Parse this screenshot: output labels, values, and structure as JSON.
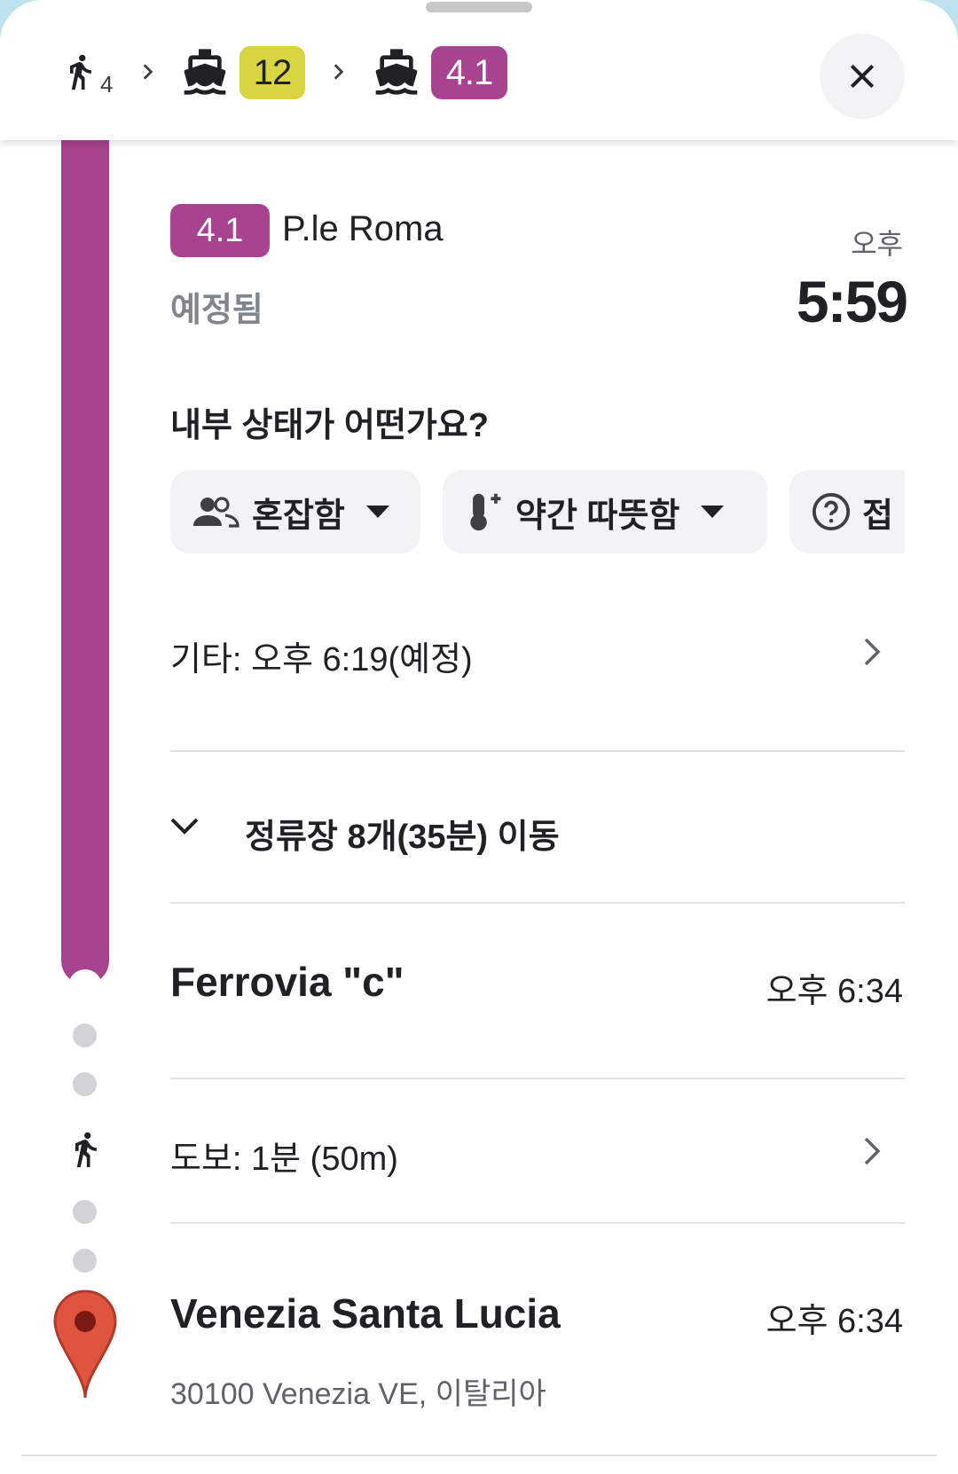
{
  "header": {
    "walk_minutes": "4",
    "legs": [
      {
        "icon": "ferry-icon",
        "line": "12",
        "color": "#d7d540",
        "text_color": "#202124"
      },
      {
        "icon": "ferry-icon",
        "line": "4.1",
        "color": "#a8448f",
        "text_color": "#ffffff"
      }
    ]
  },
  "departure": {
    "line": "4.1",
    "line_color": "#a8448f",
    "stop_name": "P.le Roma",
    "status": "예정됨",
    "time_period": "오후",
    "time": "5:59"
  },
  "crowding": {
    "question": "내부 상태가 어떤가요?",
    "chips": [
      {
        "icon": "people-icon",
        "label": "혼잡함"
      },
      {
        "icon": "thermometer-icon",
        "label": "약간 따뜻함"
      },
      {
        "icon": "help-circle-icon",
        "label": "접"
      }
    ]
  },
  "other_departure": "기타: 오후 6:19(예정)",
  "stops_summary": "정류장 8개(35분) 이동",
  "arrival_stop": {
    "name": "Ferrovia \"c\"",
    "time": "오후 6:34"
  },
  "walk_step": "도보: 1분 (50m)",
  "destination": {
    "name": "Venezia Santa Lucia",
    "address": "30100 Venezia VE, 이탈리아",
    "time": "오후 6:34"
  },
  "colors": {
    "route": "#a8448f",
    "line12": "#d7d540",
    "pin": "#e0533f"
  }
}
